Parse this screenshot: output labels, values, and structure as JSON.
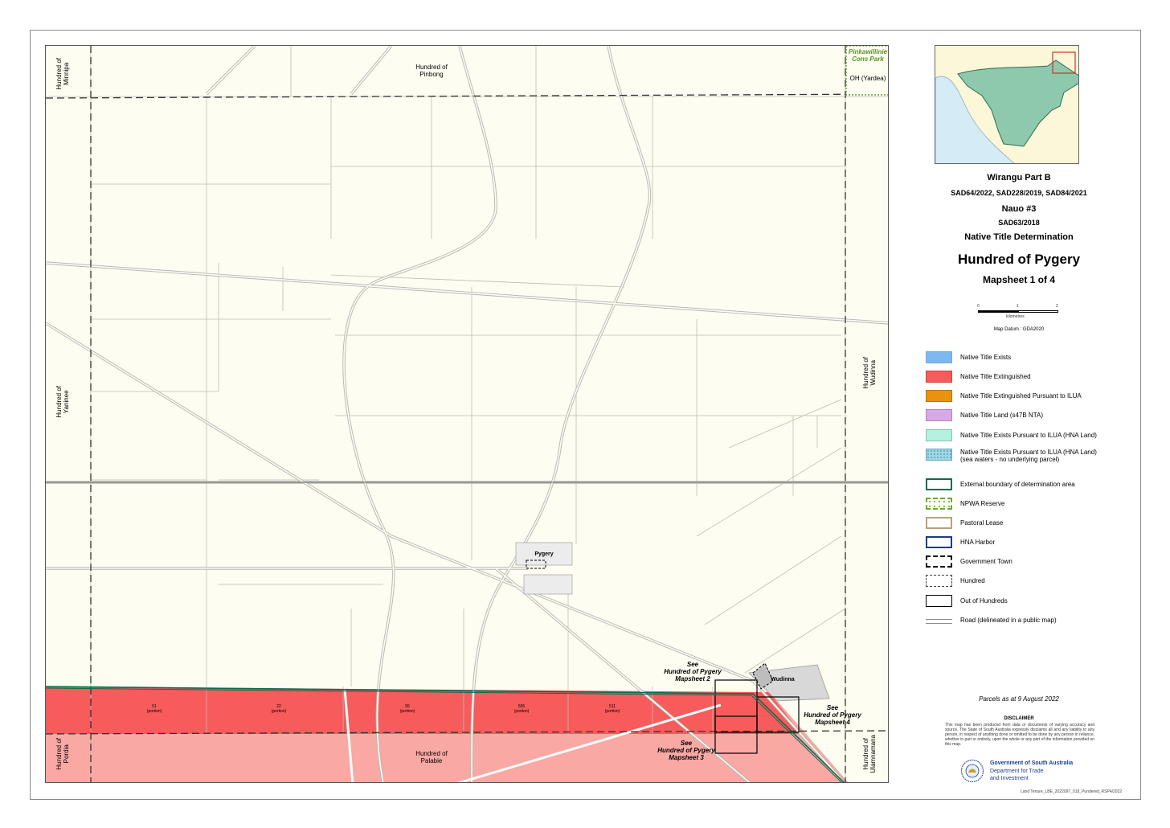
{
  "map": {
    "hundreds": {
      "pinbong": "Hundred of\nPinbong",
      "minnipa": "Hundred of\nMinnipa",
      "yaninee": "Hundred of\nYaninee",
      "wudinna": "Hundred of\nWudinna",
      "pordia": "Hundred of\nPordia",
      "palabie": "Hundred of\nPalabie",
      "ulamnamana": "Hundred of\nUlamnamana"
    },
    "reserve": {
      "name": "Pinkawillinie\nCons Park",
      "oh": "OH (Yardea)"
    },
    "towns": {
      "pygery": "Pygery",
      "wudinna": "Wudinna"
    },
    "see_refs": {
      "ms2": "See\nHundred of Pygery\nMapsheet 2",
      "ms3": "See\nHundred of Pygery\nMapsheet 3",
      "ms4": "See\nHundred of Pygery\nMapsheet 4"
    },
    "parcel_labels": [
      {
        "id": "51",
        "note": "(portion)"
      },
      {
        "id": "22",
        "note": "(portion)"
      },
      {
        "id": "55",
        "note": "(portion)"
      },
      {
        "id": "506",
        "note": "(portion)"
      },
      {
        "id": "511",
        "note": "(portion)"
      }
    ],
    "colors": {
      "background": "#fdfdf1",
      "extinguished": "#f75b5b",
      "extinguished_light": "#f9a8a4",
      "road": "#c9c9c9",
      "reserve_border": "#6aa832",
      "boundary_green": "#0d6b4e"
    }
  },
  "inset": {
    "colors": {
      "land": "#fbf7d8",
      "water": "#d5ecf7",
      "area": "#8fc9ad",
      "box": "#c0392b"
    }
  },
  "title": {
    "line1": "Wirangu Part B",
    "line2": "SAD64/2022, SAD228/2019, SAD84/2021",
    "line3": "Nauo #3",
    "line4": "SAD63/2018",
    "line5": "Native Title Determination",
    "line6": "Hundred of Pygery",
    "line7": "Mapsheet 1 of 4"
  },
  "scale": {
    "ticks": [
      "0",
      "1",
      "2"
    ],
    "unit": "kilometres"
  },
  "datum": "Map Datum : GDA2020",
  "legend": [
    {
      "label": "Native Title Exists",
      "color": "#7db9f0",
      "style": "fill"
    },
    {
      "label": "Native Title Extinguished",
      "color": "#f75b5b",
      "style": "fill"
    },
    {
      "label": "Native Title Extinguished Pursuant to ILUA",
      "color": "#e8930e",
      "style": "fill"
    },
    {
      "label": "Native Title Land (s47B NTA)",
      "color": "#d9a8e6",
      "style": "fill"
    },
    {
      "label": "Native Title Exists Pursuant to ILUA (HNA Land)",
      "color": "#b6f0de",
      "style": "fill"
    },
    {
      "label": "Native Title Exists Pursuant to ILUA (HNA Land)\n(sea waters - no underlying parcel)",
      "color": "#9fd7e6",
      "style": "dots"
    },
    {
      "label": "External boundary of determination area",
      "color": "#0d6b4e",
      "style": "outline"
    },
    {
      "label": "NPWA Reserve",
      "color": "#6aa832",
      "style": "reserve"
    },
    {
      "label": "Pastoral Lease",
      "color": "#b8a27a",
      "style": "outline"
    },
    {
      "label": "HNA Harbor",
      "color": "#1d3b86",
      "style": "outline"
    },
    {
      "label": "Government Town",
      "color": "#000000",
      "style": "dash"
    },
    {
      "label": "Hundred",
      "color": "#333333",
      "style": "dashlong"
    },
    {
      "label": "Out of Hundreds",
      "color": "#000000",
      "style": "outline"
    },
    {
      "label": "Road (delineated in a public map)",
      "color": "#8a8a8a",
      "style": "road"
    }
  ],
  "parcels_date": "Parcels as at 9 August 2022",
  "disclaimer": {
    "title": "DISCLAIMER",
    "body": "This map has been produced from data or documents of varying accuracy and source. The State of South Australia expressly disclaims all and any liability to any person, in respect of anything done or omitted to be done by any person in reliance, whether in part or entirely, upon the whole or any part of the information provided on this map."
  },
  "gov": {
    "line1": "Government of South Australia",
    "line2": "Department for Trade\nand Investment"
  },
  "docref": "Land Tenure_LBE_2022097_018_Pundered_RSP4/2022"
}
